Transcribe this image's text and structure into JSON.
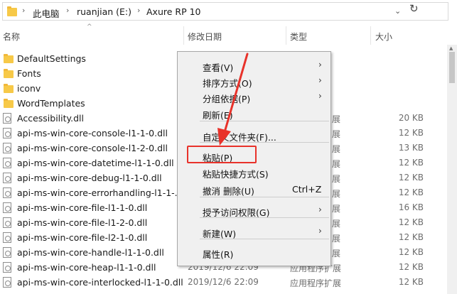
{
  "address_bar": {
    "crumbs": [
      "此电脑",
      "ruanjian (E:)",
      "Axure RP 10"
    ]
  },
  "columns": {
    "name": "名称",
    "date": "修改日期",
    "type": "类型",
    "size": "大小"
  },
  "files": [
    {
      "name": "DefaultSettings",
      "kind": "folder",
      "date": "",
      "type": "",
      "size": ""
    },
    {
      "name": "Fonts",
      "kind": "folder",
      "date": "",
      "type": "",
      "size": ""
    },
    {
      "name": "iconv",
      "kind": "folder",
      "date": "",
      "type": "",
      "size": ""
    },
    {
      "name": "WordTemplates",
      "kind": "folder",
      "date": "",
      "type": "",
      "size": ""
    },
    {
      "name": "Accessibility.dll",
      "kind": "dll",
      "date": "",
      "type": "展",
      "size": "20 KB"
    },
    {
      "name": "api-ms-win-core-console-l1-1-0.dll",
      "kind": "dll",
      "date": "",
      "type": "展",
      "size": "12 KB"
    },
    {
      "name": "api-ms-win-core-console-l1-2-0.dll",
      "kind": "dll",
      "date": "",
      "type": "展",
      "size": "13 KB"
    },
    {
      "name": "api-ms-win-core-datetime-l1-1-0.dll",
      "kind": "dll",
      "date": "",
      "type": "展",
      "size": "12 KB"
    },
    {
      "name": "api-ms-win-core-debug-l1-1-0.dll",
      "kind": "dll",
      "date": "",
      "type": "展",
      "size": "12 KB"
    },
    {
      "name": "api-ms-win-core-errorhandling-l1-1-...",
      "kind": "dll",
      "date": "",
      "type": "展",
      "size": "12 KB"
    },
    {
      "name": "api-ms-win-core-file-l1-1-0.dll",
      "kind": "dll",
      "date": "",
      "type": "展",
      "size": "16 KB"
    },
    {
      "name": "api-ms-win-core-file-l1-2-0.dll",
      "kind": "dll",
      "date": "",
      "type": "展",
      "size": "12 KB"
    },
    {
      "name": "api-ms-win-core-file-l2-1-0.dll",
      "kind": "dll",
      "date": "",
      "type": "展",
      "size": "12 KB"
    },
    {
      "name": "api-ms-win-core-handle-l1-1-0.dll",
      "kind": "dll",
      "date": "",
      "type": "展",
      "size": "12 KB"
    },
    {
      "name": "api-ms-win-core-heap-l1-1-0.dll",
      "kind": "dll",
      "date": "2019/12/6 22:09",
      "type": "应用程序扩展",
      "size": "12 KB"
    },
    {
      "name": "api-ms-win-core-interlocked-l1-1-0.dll",
      "kind": "dll",
      "date": "2019/12/6 22:09",
      "type": "应用程序扩展",
      "size": "12 KB"
    }
  ],
  "context_menu": {
    "items": [
      {
        "label": "查看(V)",
        "shortcut": "",
        "submenu": true
      },
      {
        "label": "排序方式(O)",
        "shortcut": "",
        "submenu": true
      },
      {
        "label": "分组依据(P)",
        "shortcut": "",
        "submenu": true
      },
      {
        "label": "刷新(E)",
        "shortcut": "",
        "submenu": false
      },
      {
        "label": "自定义文件夹(F)...",
        "shortcut": "",
        "submenu": false
      },
      {
        "label": "粘贴(P)",
        "shortcut": "",
        "submenu": false
      },
      {
        "label": "粘贴快捷方式(S)",
        "shortcut": "",
        "submenu": false
      },
      {
        "label": "撤消 删除(U)",
        "shortcut": "Ctrl+Z",
        "submenu": false
      },
      {
        "label": "授予访问权限(G)",
        "shortcut": "",
        "submenu": true
      },
      {
        "label": "新建(W)",
        "shortcut": "",
        "submenu": true
      },
      {
        "label": "属性(R)",
        "shortcut": "",
        "submenu": false
      }
    ],
    "highlighted": "粘贴(P)"
  },
  "colors": {
    "folder": "#f7c948",
    "annotation_red": "#e8322a",
    "menu_bg": "#f0f0f0"
  }
}
